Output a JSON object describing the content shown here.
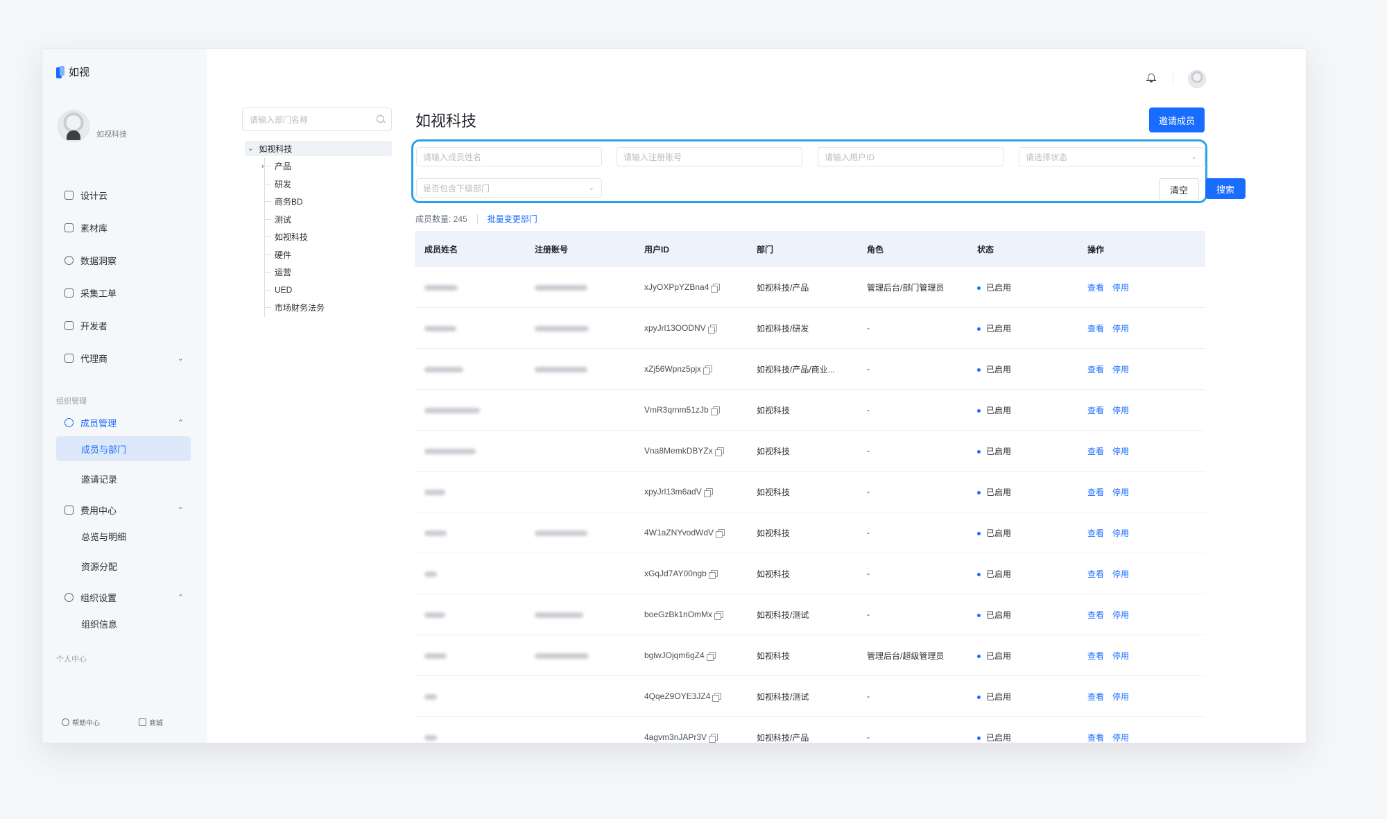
{
  "app": {
    "logo_text": "如视"
  },
  "profile": {
    "org_name": "如视科技"
  },
  "sidebar": {
    "items": [
      {
        "label": "设计云",
        "icon": "monitor-icon"
      },
      {
        "label": "素材库",
        "icon": "folder-icon"
      },
      {
        "label": "数据洞察",
        "icon": "pie-chart-icon"
      },
      {
        "label": "采集工单",
        "icon": "document-icon"
      },
      {
        "label": "开发者",
        "icon": "code-icon"
      },
      {
        "label": "代理商",
        "icon": "briefcase-icon"
      }
    ],
    "section_org": "组织管理",
    "member_mgmt": {
      "label": "成员管理",
      "children": [
        "成员与部门",
        "邀请记录"
      ]
    },
    "billing": {
      "label": "费用中心",
      "children": [
        "总览与明细",
        "资源分配"
      ]
    },
    "org_settings": {
      "label": "组织设置",
      "children": [
        "组织信息"
      ]
    },
    "section_personal": "个人中心",
    "help": "帮助中心",
    "store": "商城"
  },
  "dept_tree": {
    "search_placeholder": "请输入部门名称",
    "root": "如视科技",
    "children": [
      "产品",
      "研发",
      "商务BD",
      "测试",
      "如视科技",
      "硬件",
      "运营",
      "UED",
      "市场财务法务"
    ]
  },
  "main": {
    "title": "如视科技",
    "invite_button": "邀请成员",
    "filters": {
      "name_placeholder": "请输入成员姓名",
      "account_placeholder": "请输入注册账号",
      "userid_placeholder": "请输入用户ID",
      "status_placeholder": "请选择状态",
      "include_sub_placeholder": "是否包含下级部门",
      "clear_button": "清空",
      "search_button": "搜索"
    },
    "summary": {
      "count_label": "成员数量: 245",
      "batch_link": "批量变更部门"
    }
  },
  "table": {
    "columns": [
      "成员姓名",
      "注册账号",
      "用户ID",
      "部门",
      "角色",
      "状态",
      "操作"
    ],
    "rows": [
      {
        "uid": "xJyOXPpYZBna4",
        "dept": "如视科技/产品",
        "role": "管理后台/部门管理员",
        "status": "已启用"
      },
      {
        "uid": "xpyJrl13OODNV",
        "dept": "如视科技/研发",
        "role": "-",
        "status": "已启用"
      },
      {
        "uid": "xZj56Wpnz5pjx",
        "dept": "如视科技/产品/商业...",
        "role": "-",
        "status": "已启用"
      },
      {
        "uid": "VmR3qrnm51zJb",
        "dept": "如视科技",
        "role": "-",
        "status": "已启用"
      },
      {
        "uid": "Vna8MemkDBYZx",
        "dept": "如视科技",
        "role": "-",
        "status": "已启用"
      },
      {
        "uid": "xpyJrl13m6adV",
        "dept": "如视科技",
        "role": "-",
        "status": "已启用"
      },
      {
        "uid": "4W1aZNYvodWdV",
        "dept": "如视科技",
        "role": "-",
        "status": "已启用"
      },
      {
        "uid": "xGqJd7AY00ngb",
        "dept": "如视科技",
        "role": "-",
        "status": "已启用"
      },
      {
        "uid": "boeGzBk1nOmMx",
        "dept": "如视科技/测试",
        "role": "-",
        "status": "已启用"
      },
      {
        "uid": "bglwJOjqm6gZ4",
        "dept": "如视科技",
        "role": "管理后台/超级管理员",
        "status": "已启用"
      },
      {
        "uid": "4QqeZ9OYE3JZ4",
        "dept": "如视科技/测试",
        "role": "-",
        "status": "已启用"
      },
      {
        "uid": "4agvm3nJAPr3V",
        "dept": "如视科技/产品",
        "role": "-",
        "status": "已启用"
      }
    ],
    "actions": {
      "view": "查看",
      "disable": "停用"
    }
  }
}
